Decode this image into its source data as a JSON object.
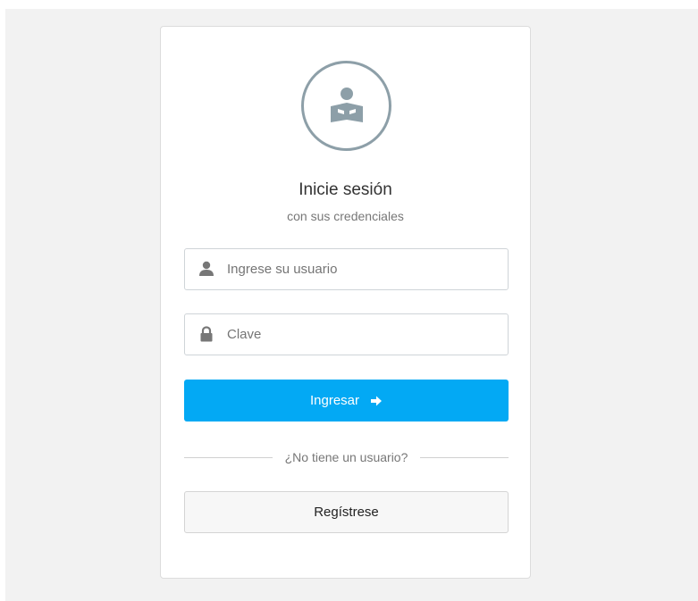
{
  "colors": {
    "page_background": "#f2f2f2",
    "card_background": "#ffffff",
    "accent": "#03a9f4",
    "icon_gray": "#8d9fa8"
  },
  "header": {
    "avatar_icon": "user-reading-icon",
    "title": "Inicie sesión",
    "subtitle": "con sus credenciales"
  },
  "form": {
    "username": {
      "icon": "user-icon",
      "placeholder": "Ingrese su usuario",
      "value": ""
    },
    "password": {
      "icon": "lock-icon",
      "placeholder": "Clave",
      "value": ""
    },
    "submit_label": "Ingresar",
    "submit_icon": "arrow-right-icon"
  },
  "divider_text": "¿No tiene un usuario?",
  "register_label": "Regístrese"
}
